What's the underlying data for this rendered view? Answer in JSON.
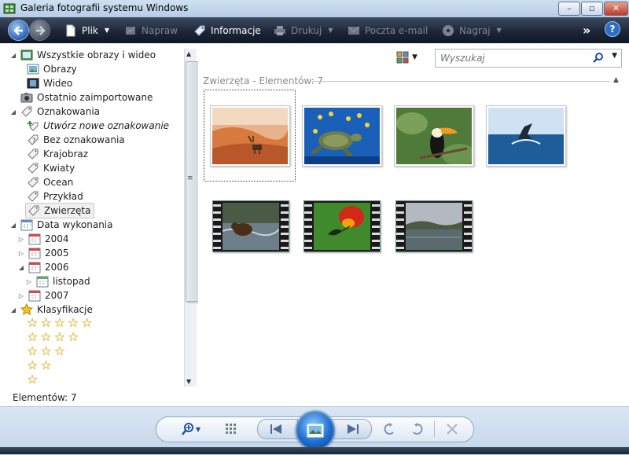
{
  "window": {
    "title": "Galeria fotografii systemu Windows",
    "buttons": {
      "minimize": "–",
      "maximize": "▫",
      "close": "✕"
    }
  },
  "command_bar": {
    "back_icon": "back-arrow-icon",
    "forward_icon": "forward-arrow-icon",
    "file": {
      "label": "Plik",
      "icon": "document-icon"
    },
    "fix": {
      "label": "Napraw",
      "icon": "fix-icon"
    },
    "info": {
      "label": "Informacje",
      "icon": "tag-icon"
    },
    "print": {
      "label": "Drukuj",
      "icon": "printer-icon"
    },
    "email": {
      "label": "Poczta e-mail",
      "icon": "email-icon"
    },
    "burn": {
      "label": "Nagraj",
      "icon": "disc-icon"
    },
    "more": "»",
    "help": "?"
  },
  "nav": {
    "all_media": "Wszystkie obrazy i wideo",
    "images": "Obrazy",
    "video": "Wideo",
    "recently_imported": "Ostatnio zaimportowane",
    "tags": "Oznakowania",
    "create_tag": "Utwórz nowe oznakowanie",
    "untagged": "Bez oznakowania",
    "tag_items": [
      "Krajobraz",
      "Kwiaty",
      "Ocean",
      "Przykład",
      "Zwierzęta"
    ],
    "date_taken": "Data wykonania",
    "years": [
      "2004",
      "2005",
      "2006",
      "2007"
    ],
    "month": "listopad",
    "ratings": "Klasyfikacje",
    "star_rows": [
      5,
      4,
      3,
      2,
      1
    ]
  },
  "status": {
    "count": "Elementów: 7"
  },
  "main": {
    "search_placeholder": "Wyszukaj",
    "group_header": "Zwierzęta - Elementów: 7",
    "photos": [
      "desert-oryx",
      "sea-turtle",
      "toucan",
      "whale-tail"
    ],
    "videos": [
      "bear-river",
      "hummingbird-flower",
      "lake-landscape"
    ]
  },
  "colors": {
    "accent": "#1e6fd1",
    "cmdbar": "#1d2738",
    "bottombar": "#c4d6ea"
  }
}
